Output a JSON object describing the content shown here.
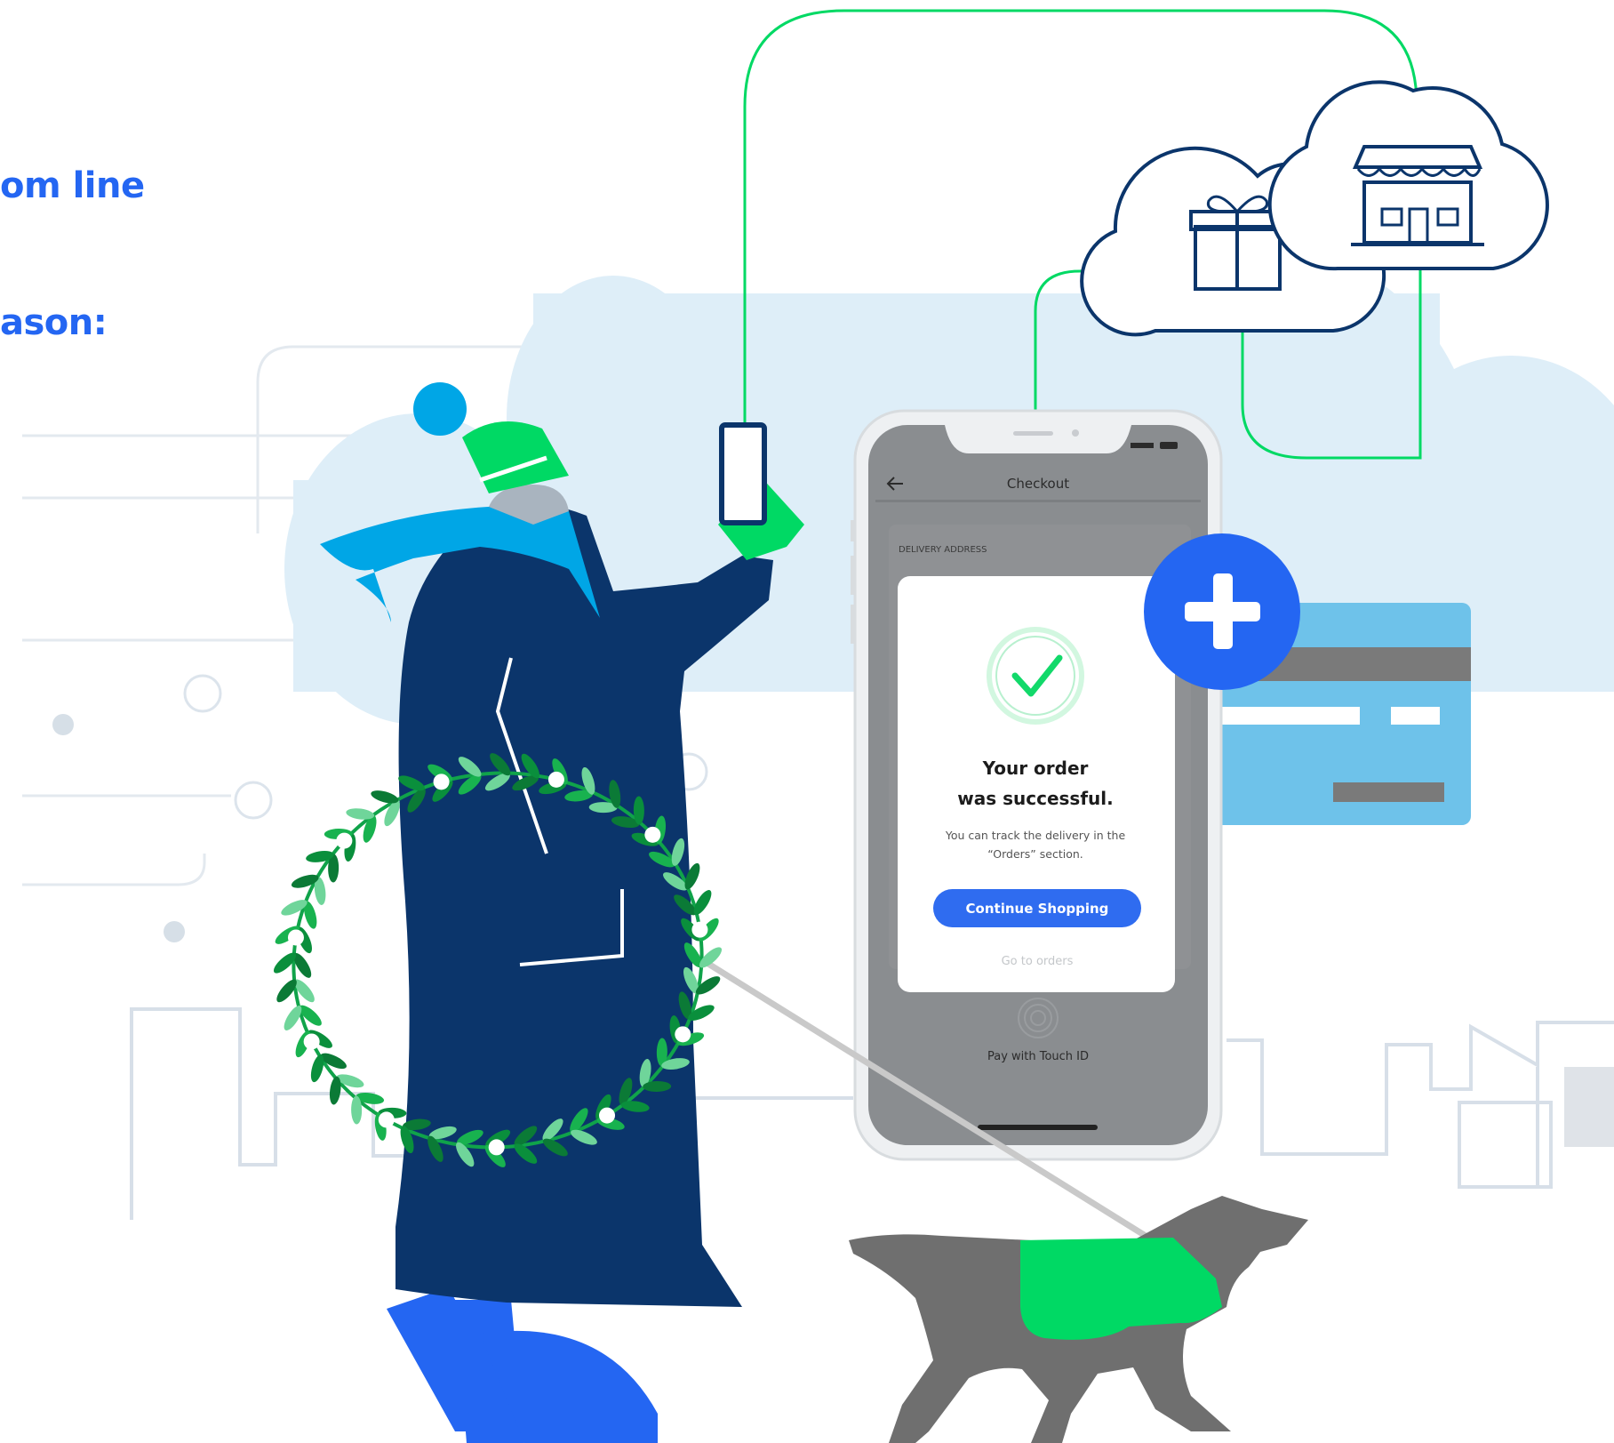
{
  "headline": {
    "line1": "om line",
    "line2": "ason:"
  },
  "phone": {
    "screen_title": "Checkout",
    "back_icon": "back-arrow-icon",
    "section_label": "DELIVERY ADDRESS",
    "success_heading_line1": "Your order",
    "success_heading_line2": "was successful.",
    "success_body_line1": "You can track the delivery in the",
    "success_body_line2": "“Orders” section.",
    "primary_button": "Continue Shopping",
    "secondary_link": "Go to orders",
    "touch_id_label": "Pay with Touch ID"
  },
  "icons": {
    "gift_cloud": "gift-cloud-icon",
    "store_cloud": "store-cloud-icon",
    "add": "plus-icon",
    "card": "credit-card-icon",
    "check": "checkmark-icon",
    "fingerprint": "fingerprint-icon"
  },
  "colors": {
    "headline_blue": "#2466f2",
    "navy": "#0b356b",
    "green": "#00d964",
    "light_blue": "#6ec2ea",
    "cloud_blue": "#deeef8",
    "button_blue": "#2f6cf0",
    "dog_gray": "#6f6f6f"
  }
}
